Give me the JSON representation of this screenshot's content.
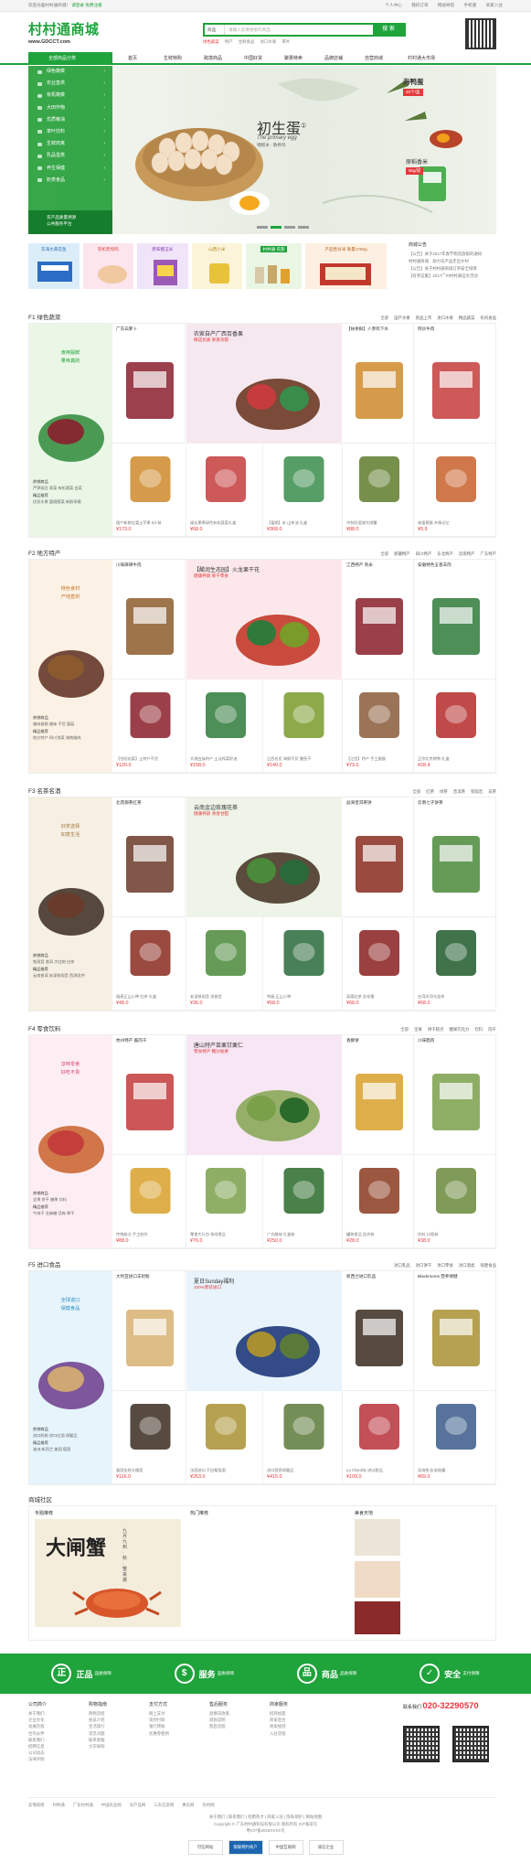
{
  "topbar": {
    "welcome": "欢迎光临村村通商城！",
    "login": "请登录",
    "register": "免费注册",
    "links": [
      "个人中心",
      "我的订单",
      "网站导航",
      "手机版",
      "商家入驻"
    ]
  },
  "header": {
    "logo_text": "村村通商城",
    "logo_url": "www.GDCCT.com",
    "search": {
      "category": "商品",
      "placeholder": "请输入您要搜索的商品",
      "button": "搜 索",
      "hot": [
        "绿色蔬菜",
        "特产",
        "生鲜食品",
        "进口水果",
        "茶叶"
      ]
    }
  },
  "nav": {
    "all": "全部商品分类",
    "items": [
      "首页",
      "生鲜特购",
      "跨境商品",
      "中国好货",
      "聚惠特卖",
      "品牌店铺",
      "自营商城",
      "村村通大市场"
    ]
  },
  "sidebar": {
    "items": [
      "绿色蔬菜",
      "农业直供",
      "有机蔬菜",
      "大田作物",
      "优质粮油",
      "茶叶饮料",
      "生鲜肉禽",
      "乳品蛋类",
      "养生保健",
      "奶类食品"
    ],
    "promo": [
      "农产品质量溯源",
      "公共服务平台"
    ]
  },
  "banner": {
    "title": "初生蛋",
    "sup": "①",
    "en": "The primary egg",
    "sub": "喂糙米 · 散养鸡",
    "duck_name": "海鸭蛋",
    "duck_tag": "20个/盒",
    "rice_name": "原稻香米",
    "rice_tag": "5kg/袋"
  },
  "ads": [
    {
      "label": "东海大黄花鱼"
    },
    {
      "label": "有机老母鸡"
    },
    {
      "label": "原味糯玉米"
    },
    {
      "label": "山西小米"
    },
    {
      "label": "村村通 农旅"
    },
    {
      "label": "产品售价米 限量1750g"
    }
  ],
  "notice": {
    "title": "商城公告",
    "lines": [
      "【公告】关于2017年春节物流放假的通知",
      "村村通商城：助力农产品走出乡村",
      "【公告】关于村村通商城订单安全保障",
      "【有奖征集】2017广州村村通征文活动"
    ]
  },
  "floors": [
    {
      "title": "F1 绿色蔬菜",
      "tabs": [
        "全部",
        "国产水果",
        "新品上市",
        "进口水果",
        "精品蔬菜",
        "有机食品"
      ],
      "slogan": [
        "食用殷鲜",
        "果味真的"
      ],
      "kw_head": "热销商品",
      "kw": "芦笋豌豆 青菜 有机蔬菜 白菜",
      "kw_head2": "精品推荐",
      "kw2": "优质水果 富硒蔬菜 新鲜采摘",
      "items": [
        {
          "nm": "广东白萝卜",
          "ds": "",
          "pr": ""
        },
        {
          "nm": "农家自产广西百香果",
          "ds": "精选优质 果香浓郁",
          "pr": ""
        },
        {
          "nm": "【扶余鲜】人参鸡下水",
          "ds": "100g/个",
          "pr": ""
        },
        {
          "nm": "阿炒牛肉",
          "ds": "",
          "pr": ""
        },
        {
          "nm": "",
          "ds": "国产新鲜红富士苹果 5斤装",
          "pr": "¥173.0"
        },
        {
          "nm": "",
          "ds": "福佳果果绿色有机蔬菜礼盒",
          "pr": "¥68.0"
        },
        {
          "nm": "",
          "ds": "【富硒】米 山茶油 礼盒",
          "pr": "¥368.0"
        },
        {
          "nm": "",
          "ds": "中秋阳澄湖大闸蟹",
          "pr": "¥88.0"
        },
        {
          "nm": "",
          "ds": "咸蛋黄酥 乡情记忆",
          "pr": "¥5.9"
        }
      ]
    },
    {
      "title": "F2 地方特产",
      "tabs": [
        "全部",
        "新疆特产",
        "四川特产",
        "东北特产",
        "云南特产",
        "广东特产"
      ],
      "slogan": [
        "特色食材",
        "产地直供"
      ],
      "kw_head": "热销商品",
      "kw": "腊肉香肠 腊味 干货 菌菇",
      "kw_head2": "精品推荐",
      "kw2": "地方特产 四川泡菜 湖南腊肉",
      "items": [
        {
          "nm": "川味麻辣牛肉",
          "ds": "",
          "pr": ""
        },
        {
          "nm": "【酸润生态园】火龙果干花",
          "ds": "健康养颜 果干零食",
          "pr": ""
        },
        {
          "nm": "江西特产 贡米",
          "ds": "",
          "pr": ""
        },
        {
          "nm": "安徽特色五香羊肉",
          "ds": "",
          "pr": ""
        },
        {
          "nm": "",
          "ds": "【合阳花菜】土特产干货",
          "pr": "¥120.0"
        },
        {
          "nm": "",
          "ds": "大理白族特产 土法榨菜籽油",
          "pr": "¥158.0"
        },
        {
          "nm": "",
          "ds": "江西名优 海鲜干货 墨鱼干",
          "pr": "¥140.0"
        },
        {
          "nm": "",
          "ds": "【江西】特产 手工腊肠",
          "pr": "¥73.0"
        },
        {
          "nm": "",
          "ds": "正宗北京烤鸭 礼盒",
          "pr": "¥28.4"
        }
      ]
    },
    {
      "title": "F3 名茶名酒",
      "tabs": [
        "全部",
        "红茶",
        "绿茶",
        "普洱茶",
        "铁观音",
        "白茶"
      ],
      "slogan": [
        "好茶选择",
        "如意生活"
      ],
      "kw_head": "热销商品",
      "kw": "铁观音 普洱 大红袍 白茶",
      "kw_head2": "精品推荐",
      "kw2": "云南普洱 安溪铁观音 西湖龙井",
      "items": [
        {
          "nm": "北苑御茶红茶",
          "ds": "",
          "pr": ""
        },
        {
          "nm": "云南金边玫瑰花茶",
          "ds": "健康养颜 清香甘甜",
          "pr": ""
        },
        {
          "nm": "勐海普洱茶饼",
          "ds": "",
          "pr": ""
        },
        {
          "nm": "云南七子饼茶",
          "ds": "",
          "pr": ""
        },
        {
          "nm": "",
          "ds": "福建正山小种 红茶 礼盒",
          "pr": "¥48.0"
        },
        {
          "nm": "",
          "ds": "安溪铁观音 浓香型",
          "pr": "¥36.0"
        },
        {
          "nm": "",
          "ds": "特级 正山小种",
          "pr": "¥58.0"
        },
        {
          "nm": "",
          "ds": "英德红茶 金毛毫",
          "pr": "¥68.0"
        },
        {
          "nm": "",
          "ds": "台湾冻顶乌龙茶",
          "pr": "¥68.0"
        }
      ]
    },
    {
      "title": "F4 零食饮料",
      "tabs": [
        "全部",
        "坚果",
        "饼干糕点",
        "糖果巧克力",
        "饮料",
        "肉干"
      ],
      "slogan": [
        "淳味零食",
        "好吃不贵"
      ],
      "kw_head": "热销商品",
      "kw": "坚果 饼干 糖果 饮料",
      "kw_head2": "精品推荐",
      "kw2": "牛肉干 芝麻糖 话梅 果干",
      "items": [
        {
          "nm": "杭州特产 酱肉干",
          "ds": "",
          "pr": ""
        },
        {
          "nm": "唐山特产苗栗甘栗仁",
          "ds": "零食特产 糖炒板栗",
          "pr": ""
        },
        {
          "nm": "香酥饼",
          "ds": "",
          "pr": ""
        },
        {
          "nm": "川味腊肉",
          "ds": "",
          "pr": ""
        },
        {
          "nm": "",
          "ds": "传统糕点 手工制作",
          "pr": "¥88.0"
        },
        {
          "nm": "",
          "ds": "零食大礼包 休闲食品",
          "pr": "¥76.0"
        },
        {
          "nm": "",
          "ds": "广式腊味 礼盒装",
          "pr": "¥250.0"
        },
        {
          "nm": "",
          "ds": "罐装食品 组合装",
          "pr": "¥28.0"
        },
        {
          "nm": "",
          "ds": "饮料 12瓶装",
          "pr": "¥38.0"
        }
      ]
    },
    {
      "title": "F5 进口食品",
      "tabs": [
        "进口乳品",
        "进口饼干",
        "进口零食",
        "进口酒类",
        "保健食品"
      ],
      "slogan": [
        "全球进口",
        "保健食品"
      ],
      "kw_head": "热销商品",
      "kw": "进口奶粉 进口红酒 保健品",
      "kw_head2": "精品推荐",
      "kw2": "澳洲 新西兰 美国 德国",
      "items": [
        {
          "nm": "大利亚进口羊奶粉",
          "ds": "",
          "pr": ""
        },
        {
          "nm": "夏日Sunday福利",
          "ds": "100%原装进口",
          "pr": ""
        },
        {
          "nm": "新西兰进口乳品",
          "ds": "",
          "pr": ""
        },
        {
          "nm": "Blackmores 营养保健",
          "ds": "",
          "pr": ""
        },
        {
          "nm": "",
          "ds": "泰国金枕头榴莲",
          "pr": "¥116.0"
        },
        {
          "nm": "",
          "ds": "法国进口 干白葡萄酒",
          "pr": "¥263.0"
        },
        {
          "nm": "",
          "ds": "进口营养保健品",
          "pr": "¥415.0"
        },
        {
          "nm": "",
          "ds": "La Chantilly 进口甜品",
          "pr": "¥109.0"
        },
        {
          "nm": "",
          "ds": "深海鱼油 软胶囊",
          "pr": "¥69.0"
        }
      ]
    }
  ],
  "community": {
    "title": "商城社区",
    "cols": [
      "专题推荐",
      "热门推荐",
      "美食天地"
    ],
    "crab_text": "大闸蟹",
    "crab_sub": "九月九到 · 秋 · 蟹来袭"
  },
  "services": [
    {
      "icon": "正",
      "label": "正品",
      "sm": "品质保障"
    },
    {
      "icon": "$",
      "label": "服务",
      "sm": "品质保障"
    },
    {
      "icon": "品",
      "label": "商品",
      "sm": "品质保障"
    },
    {
      "icon": "✓",
      "label": "安全",
      "sm": "支付保障"
    }
  ],
  "footer": {
    "cols": [
      {
        "h": "公司简介",
        "l": [
          "关于我们",
          "企业文化",
          "发展历程",
          "合作伙伴",
          "联系我们",
          "招聘信息",
          "公司动态",
          "法律声明"
        ]
      },
      {
        "h": "购物指南",
        "l": [
          "购物流程",
          "会员介绍",
          "生活旅行",
          "常见问题",
          "联系客服",
          "大宗采购"
        ]
      },
      {
        "h": "支付方式",
        "l": [
          "网上支付",
          "货到付款",
          "银行转账",
          "优惠券使用"
        ]
      },
      {
        "h": "售后服务",
        "l": [
          "退换货政策",
          "退款说明",
          "售后流程"
        ]
      },
      {
        "h": "商家服务",
        "l": [
          "招商加盟",
          "商家后台",
          "商家规则",
          "入驻流程"
        ]
      }
    ],
    "contact_label": "联系我们",
    "phone": "020-32290570",
    "links": [
      "友情链接",
      "村村通",
      "广东村村通",
      "中国农业网",
      "农产品网",
      "三农信息网",
      "惠农网",
      "农村网"
    ],
    "copy1": "关于我们 | 联系我们 | 招聘英才 | 商家入驻 | 隐私保护 | 网站地图",
    "copy2": "Copyright © 广东村村通科技有限公司 版权所有 ICP备案号",
    "copy3": "粤ICP备2018XXXX号",
    "badges": [
      "可信网站",
      "银联特约商户",
      "中国互联网",
      "诚信企业"
    ]
  }
}
